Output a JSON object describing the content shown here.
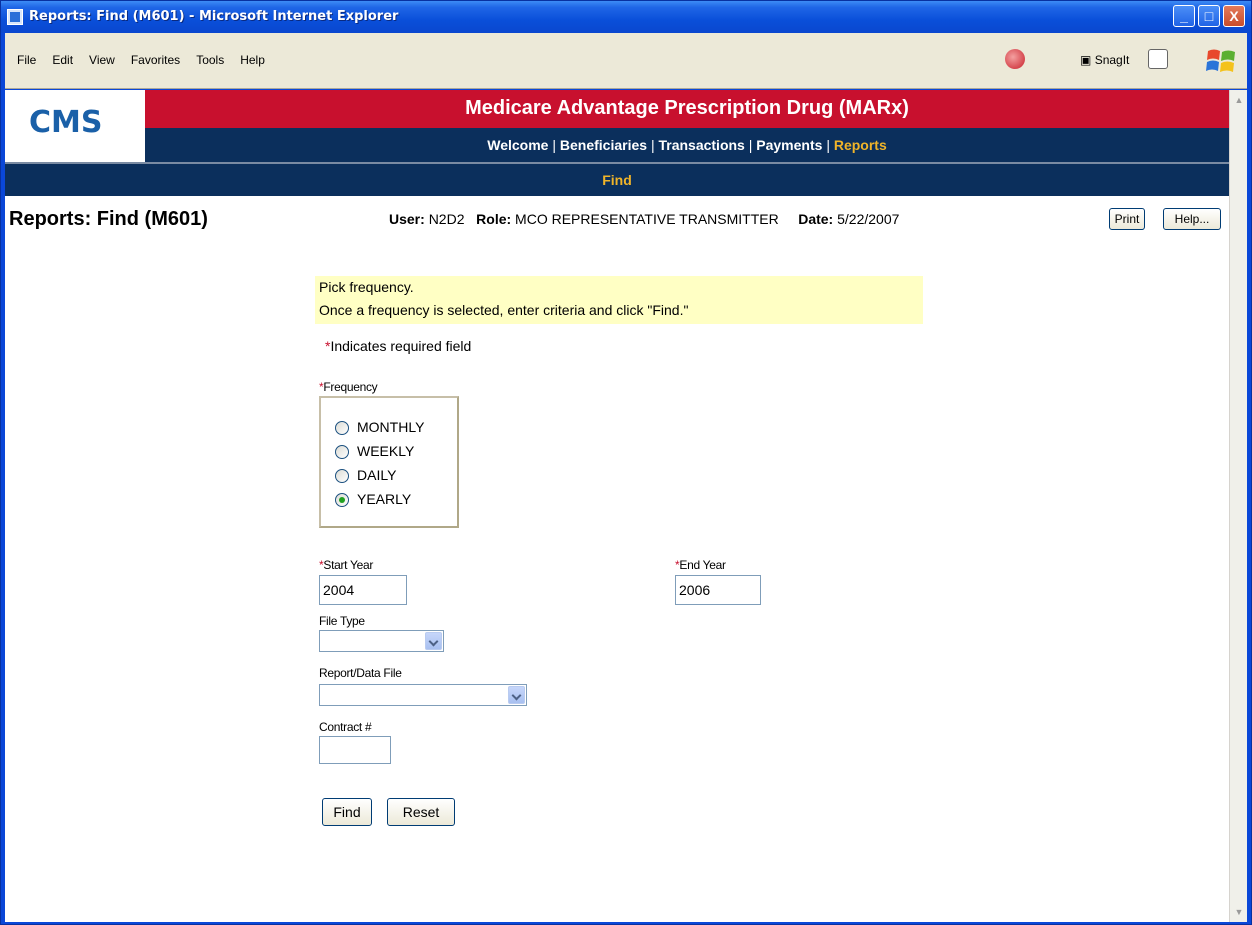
{
  "window": {
    "title": "Reports: Find (M601) - Microsoft Internet Explorer",
    "minimize": "_",
    "maximize": "□",
    "close": "X"
  },
  "menu": {
    "items": [
      "File",
      "Edit",
      "View",
      "Favorites",
      "Tools",
      "Help"
    ],
    "snagit_label": "SnagIt"
  },
  "header": {
    "logo": "CMS",
    "app_title": "Medicare Advantage Prescription Drug (MARx)",
    "nav": [
      "Welcome",
      "Beneficiaries",
      "Transactions",
      "Payments",
      "Reports"
    ],
    "nav_active": "Reports",
    "sub_nav": "Find"
  },
  "page": {
    "title": "Reports: Find (M601)",
    "user_label": "User:",
    "user_value": "N2D2",
    "role_label": "Role:",
    "role_value": "MCO REPRESENTATIVE TRANSMITTER",
    "date_label": "Date:",
    "date_value": "5/22/2007",
    "print_button": "Print",
    "help_button": "Help..."
  },
  "form": {
    "notice_line1": "Pick frequency.",
    "notice_line2": "Once a frequency is selected, enter criteria and click \"Find.\"",
    "required_note": "Indicates required field",
    "required_star": "*",
    "frequency_label": "Frequency",
    "frequency_options": [
      "MONTHLY",
      "WEEKLY",
      "DAILY",
      "YEARLY"
    ],
    "frequency_selected": "YEARLY",
    "start_year_label": "Start Year",
    "start_year_value": "2004",
    "end_year_label": "End Year",
    "end_year_value": "2006",
    "file_type_label": "File Type",
    "file_type_value": "",
    "report_label": "Report/Data File",
    "report_value": "",
    "contract_label": "Contract #",
    "contract_value": "",
    "find_button": "Find",
    "reset_button": "Reset"
  },
  "colors": {
    "banner_red": "#c8102e",
    "banner_navy": "#0b2f5c",
    "nav_active": "#f0b429",
    "notice_bg": "#ffffc4",
    "logo_blue": "#1a60a8"
  }
}
